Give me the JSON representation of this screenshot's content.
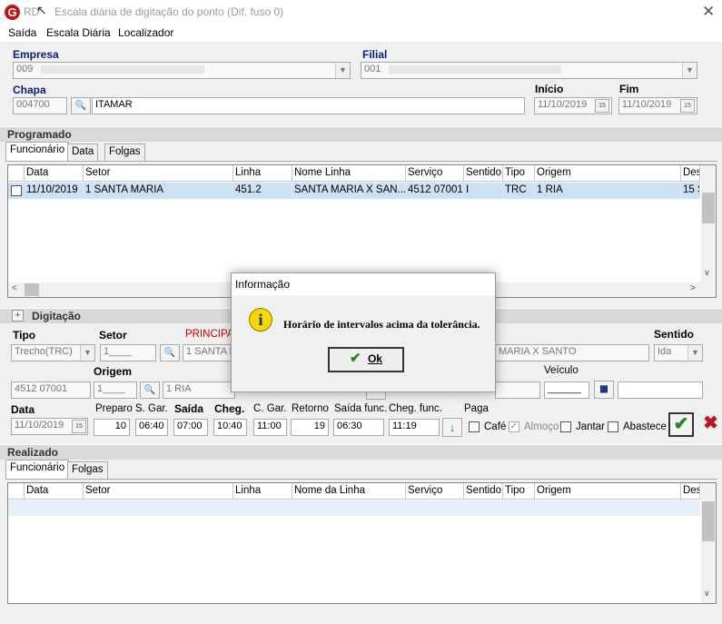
{
  "window": {
    "app_abbr": "RD",
    "title": "Escala diária de digitação do ponto (Dif. fuso 0)"
  },
  "menu": [
    "Saída",
    "Escala Diária",
    "Localizador"
  ],
  "header": {
    "empresa_label": "Empresa",
    "empresa_value": "009",
    "filial_label": "Filial",
    "filial_value": "001",
    "chapa_label": "Chapa",
    "chapa_value": "004700",
    "chapa_name": "ITAMAR",
    "inicio_label": "Início",
    "inicio_value": "11/10/2019",
    "fim_label": "Fim",
    "fim_value": "11/10/2019"
  },
  "programado": {
    "title": "Programado",
    "tabs": [
      "Funcionário",
      "Data",
      "Folgas"
    ],
    "columns": [
      "Data",
      "Setor",
      "Linha",
      "Nome Linha",
      "Serviço",
      "Sentido",
      "Tipo",
      "Origem",
      "Des"
    ],
    "rows": [
      [
        "11/10/2019",
        "1 SANTA MARIA",
        "451.2",
        "SANTA MARIA X SAN...",
        "4512 07001",
        "I",
        "TRC",
        "1 RIA",
        "15 S"
      ]
    ]
  },
  "digitacao": {
    "title": "Digitação",
    "tipo_label": "Tipo",
    "tipo_value": "Trecho(TRC)",
    "setor_label": "Setor",
    "setor_value": "1____",
    "setor_name": "1 SANTA M",
    "principal_label": "PRINCIPA",
    "linha_name": "MARIA X SANTO",
    "sentido_label": "Sentido",
    "sentido_value": "Ida",
    "servico_value": "4512 07001",
    "origem_label": "Origem",
    "origem_value": "1____",
    "origem_name": "1 RIA",
    "veiculo_label": "Veículo",
    "veiculo_value": "______",
    "data_label": "Data",
    "data_value": "11/10/2019",
    "preparo_label": "Preparo",
    "preparo_value": "10",
    "sgar_label": "S. Gar.",
    "sgar_value": "06:40",
    "saida_label": "Saída",
    "saida_value": "07:00",
    "cheg_label": "Cheg.",
    "cheg_value": "10:40",
    "cgar_label": "C. Gar.",
    "cgar_value": "11:00",
    "retorno_label": "Retorno",
    "retorno_value": "19",
    "saidafunc_label": "Saída func.",
    "saidafunc_value": "06:30",
    "chegfunc_label": "Cheg. func.",
    "chegfunc_value": "11:19",
    "paga_label": "Paga",
    "cafe_label": "Café",
    "almoco_label": "Almoço",
    "jantar_label": "Jantar",
    "abastece_label": "Abastece"
  },
  "realizado": {
    "title": "Realizado",
    "tabs": [
      "Funcionário",
      "Folgas"
    ],
    "columns": [
      "Data",
      "Setor",
      "Linha",
      "Nome da Linha",
      "Serviço",
      "Sentido",
      "Tipo",
      "Origem",
      "Des"
    ]
  },
  "dialog": {
    "title": "Informação",
    "message": "Horário de intervalos acima da tolerância.",
    "ok_label": "Ok"
  },
  "colors": {
    "accent_red": "#c0141c",
    "selected_row": "#cce2f4",
    "section_bar": "#d9d9d9",
    "principal_red": "#cc0000"
  }
}
